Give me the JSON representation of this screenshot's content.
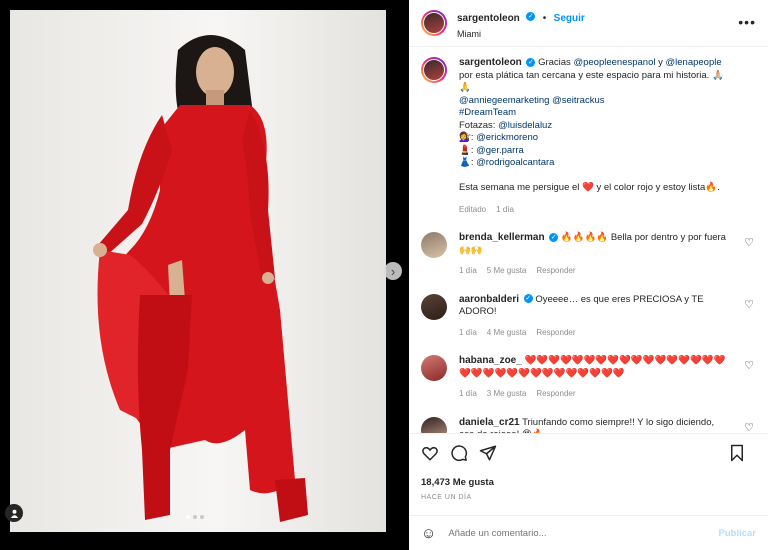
{
  "post": {
    "username": "sargentoleon",
    "follow_label": "Seguir",
    "separator": "•",
    "location": "Miami",
    "more_label": "•••"
  },
  "caption": {
    "username": "sargentoleon",
    "line1_prefix": "Gracias ",
    "mention1": "@peopleenespanol",
    "line1_mid": " y ",
    "mention2": "@lenapeople",
    "line2": "por esta plática tan cercana y este espacio para mi historia. 🙏🏼",
    "line2b": "🙏",
    "mention3": "@anniegeemarketing",
    "mention4": "@seitrackus",
    "hashtag": "#DreamTeam",
    "fotazas_label": "Fotazas: ",
    "mention5": "@luisdelaluz",
    "credit1_emoji": "💇‍♀️",
    "credit1": "@erickmoreno",
    "credit2_emoji": "💄",
    "credit2": "@ger.parra",
    "credit3_emoji": "👗",
    "credit3": "@rodrigoalcantara",
    "closing": "Esta semana me persigue el ❤️ y el color rojo y estoy lista🔥.",
    "edited": "Editado",
    "time": "1 día"
  },
  "comments": [
    {
      "username": "brenda_kellerman",
      "verified": true,
      "text": "🔥🔥🔥🔥 Bella por dentro y por fuera 🙌🙌",
      "time": "1 día",
      "likes": "5 Me gusta",
      "reply": "Responder"
    },
    {
      "username": "aaronbalderi",
      "verified": true,
      "text": "Oyeeee… es que eres PRECIOSA y TE ADORO!",
      "time": "1 día",
      "likes": "4 Me gusta",
      "reply": "Responder"
    },
    {
      "username": "habana_zoe_",
      "verified": false,
      "text": "❤️❤️❤️❤️❤️❤️❤️❤️❤️❤️❤️❤️❤️❤️❤️❤️❤️❤️❤️❤️❤️❤️❤️❤️❤️❤️❤️❤️❤️❤️❤️",
      "time": "1 día",
      "likes": "3 Me gusta",
      "reply": "Responder"
    },
    {
      "username": "daniela_cr21",
      "verified": false,
      "text": "Triunfando como siempre!! Y lo sigo diciendo, esa.de rojooo! 😍🔥",
      "time": "",
      "likes": "",
      "reply": ""
    }
  ],
  "likes_count": "18,473 Me gusta",
  "posted_ago": "HACE UN DÍA",
  "comment_input": {
    "placeholder": "Añade un comentario...",
    "post_label": "Publicar"
  },
  "icons": {
    "like": "heart-icon",
    "comment": "comment-icon",
    "share": "share-icon",
    "save": "bookmark-icon",
    "emoji": "emoji-icon",
    "tag": "user-tag-icon",
    "next": "chevron-right-icon"
  },
  "carousel": {
    "count": 3,
    "current": 1
  },
  "colors": {
    "accent": "#0095f6",
    "dress": "#d4161c",
    "mention": "#00376b"
  }
}
